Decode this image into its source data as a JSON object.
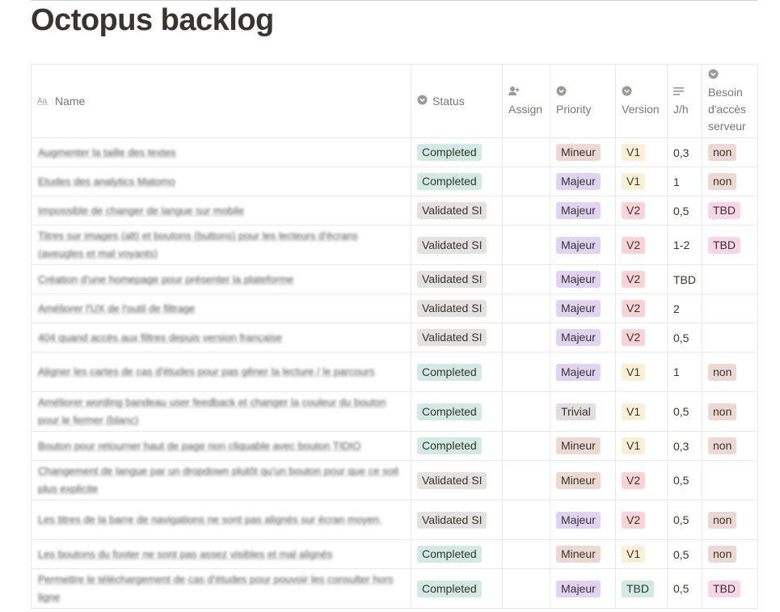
{
  "page": {
    "title": "Octopus backlog"
  },
  "columns": {
    "name": "Name",
    "status": "Status",
    "assign": "Assign",
    "priority": "Priority",
    "version": "Version",
    "jh": "J/h",
    "besoin": [
      "Besoin",
      "d'accès",
      "serveur"
    ]
  },
  "colors": {
    "Completed": "#d3eae4",
    "Validated SI": "#e3e2e0",
    "Mineur": "#ecd9d4",
    "Majeur": "#e1d4f3",
    "Trivial": "#e0dfdd",
    "V1": "#fbf0d6",
    "V2": "#f9d3d6",
    "TBD_version": "#d3eae4",
    "TBD_server": "#f9d5e8",
    "non": "#ecd9d4"
  },
  "rows": [
    {
      "name": "Augmenter la taille des textes",
      "status": "Completed",
      "priority": "Mineur",
      "version": "V1",
      "jh": "0,3",
      "server": "non"
    },
    {
      "name": "Etudes des analytics Matomo",
      "status": "Completed",
      "priority": "Majeur",
      "version": "V1",
      "jh": "1",
      "server": "non"
    },
    {
      "name": "Impossible de changer de langue sur mobile",
      "status": "Validated SI",
      "priority": "Majeur",
      "version": "V2",
      "jh": "0,5",
      "server": "TBD"
    },
    {
      "name": "Titres sur images (alt) et boutons (buttons) pour les lecteurs d'écrans (aveugles et mal voyants)",
      "status": "Validated SI",
      "priority": "Majeur",
      "version": "V2",
      "jh": "1-2",
      "server": "TBD"
    },
    {
      "name": "Création d'une homepage pour présenter la plateforme",
      "status": "Validated SI",
      "priority": "Majeur",
      "version": "V2",
      "jh": "TBD",
      "server": ""
    },
    {
      "name": "Améliorer l'UX de l'outil de filtrage",
      "status": "Validated SI",
      "priority": "Majeur",
      "version": "V2",
      "jh": "2",
      "server": ""
    },
    {
      "name": "404 quand accès aux filtres depuis version française",
      "status": "Validated SI",
      "priority": "Majeur",
      "version": "V2",
      "jh": "0,5",
      "server": ""
    },
    {
      "name": "Aligner les cartes de cas d'études pour pas gêner la lecture / le parcours",
      "status": "Completed",
      "priority": "Majeur",
      "version": "V1",
      "jh": "1",
      "server": "non"
    },
    {
      "name": "Améliorer wording bandeau user feedback et changer la couleur du bouton pour le fermer (blanc)",
      "status": "Completed",
      "priority": "Trivial",
      "version": "V1",
      "jh": "0,5",
      "server": "non"
    },
    {
      "name": "Bouton pour retourner haut de page non cliquable avec bouton TIDIO",
      "status": "Completed",
      "priority": "Mineur",
      "version": "V1",
      "jh": "0,3",
      "server": "non"
    },
    {
      "name": "Changement de langue par un dropdown plutôt qu'un bouton pour que ce soit plus explicite",
      "status": "Validated SI",
      "priority": "Mineur",
      "version": "V2",
      "jh": "0,5",
      "server": ""
    },
    {
      "name": "Les titres de la barre de navigations ne sont pas alignés sur écran moyen.",
      "status": "Validated SI",
      "priority": "Majeur",
      "version": "V2",
      "jh": "0,5",
      "server": "non"
    },
    {
      "name": "Les boutons du footer ne sont pas assez visibles et mal alignés",
      "status": "Completed",
      "priority": "Mineur",
      "version": "V1",
      "jh": "0,5",
      "server": "non"
    },
    {
      "name": "Permettre le téléchargement de cas d'études pour pouvoir les consulter hors ligne",
      "status": "Completed",
      "priority": "Majeur",
      "version": "TBD",
      "jh": "0,5",
      "server": "TBD"
    }
  ]
}
